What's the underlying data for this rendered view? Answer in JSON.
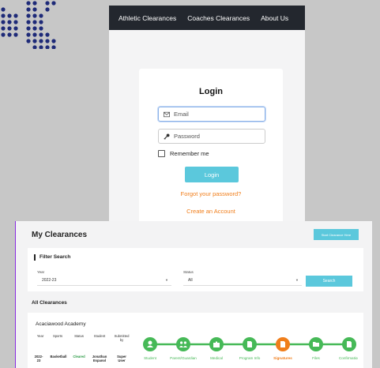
{
  "top_nav": {
    "items": [
      "Athletic Clearances",
      "Coaches Clearances",
      "About Us"
    ]
  },
  "login": {
    "title": "Login",
    "email_placeholder": "Email",
    "password_placeholder": "Password",
    "remember_label": "Remember me",
    "login_button": "Login",
    "forgot_link": "Forgot your password?",
    "create_link": "Create an Account"
  },
  "clearances": {
    "title": "My Clearances",
    "start_button": "Start Clearance Here",
    "filter": {
      "title": "Filter Search",
      "year_label": "Year",
      "year_value": "2022-23",
      "status_label": "Status",
      "status_value": "All",
      "search_button": "Search"
    },
    "all_title": "All Clearances",
    "school": "Acaciawood Academy",
    "table_headers": [
      "Year",
      "Sports",
      "Status",
      "Student",
      "Submitted by"
    ],
    "row": {
      "year": "2022-23",
      "sport": "Basketball",
      "status": "Cleared",
      "student": "Jonathan Espanol",
      "submitted_by": "Super User"
    },
    "steps": [
      {
        "label": "Student",
        "icon": "student-icon",
        "state": "done"
      },
      {
        "label": "Parent/Guardian",
        "icon": "parent-icon",
        "state": "done"
      },
      {
        "label": "Medical",
        "icon": "medical-icon",
        "state": "done"
      },
      {
        "label": "Program Info",
        "icon": "document-icon",
        "state": "done"
      },
      {
        "label": "Signatures",
        "icon": "signature-icon",
        "state": "current"
      },
      {
        "label": "Files",
        "icon": "folder-icon",
        "state": "done"
      },
      {
        "label": "Confirmation",
        "icon": "confirmation-icon",
        "state": "done"
      }
    ]
  },
  "colors": {
    "accent": "#5bc8dc",
    "orange": "#f07e1b",
    "green": "#46b957",
    "nav_bg": "#23272e",
    "dots": "#1e2a78"
  }
}
